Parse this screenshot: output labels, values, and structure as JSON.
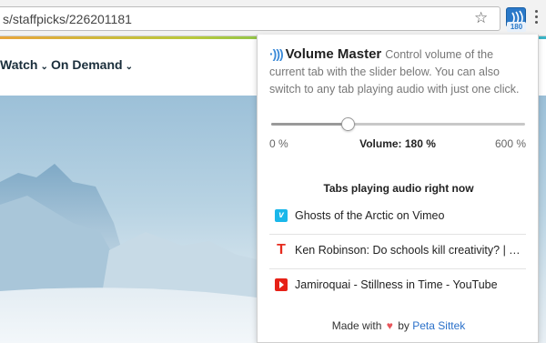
{
  "browser": {
    "url": "s/staffpicks/226201181",
    "icons": {
      "star": "star-icon",
      "extension": "volume-master-icon",
      "menu": "kebab-icon"
    },
    "extension_badge": "180"
  },
  "site": {
    "nav": [
      {
        "label": "Watch",
        "icon": "chevron-down-icon"
      },
      {
        "label": "On Demand",
        "icon": "chevron-down-icon"
      }
    ],
    "accent_colors": [
      "#e8a53a",
      "#6cc15a",
      "#3ab5c9"
    ]
  },
  "popup": {
    "title": "Volume Master",
    "description": "Control volume of the current tab with the slider below. You can also switch to any tab playing audio with just one click.",
    "slider": {
      "min_label": "0 %",
      "max_label": "600 %",
      "current_label": "Volume: 180 %",
      "value": 180,
      "min": 0,
      "max": 600
    },
    "tabs_heading": "Tabs playing audio right now",
    "tabs": [
      {
        "title": "Ghosts of the Arctic on Vimeo",
        "favicon": "vimeo-icon"
      },
      {
        "title": "Ken Robinson: Do schools kill creativity? | TED Talk",
        "favicon": "ted-icon"
      },
      {
        "title": "Jamiroquai - Stillness in Time - YouTube",
        "favicon": "youtube-icon"
      }
    ],
    "footer": {
      "prefix": "Made with",
      "middle": "by",
      "author": "Peta Sittek"
    },
    "colors": {
      "accent": "#3b8ad8",
      "heart": "#e8545a",
      "link": "#2a70c9"
    }
  }
}
